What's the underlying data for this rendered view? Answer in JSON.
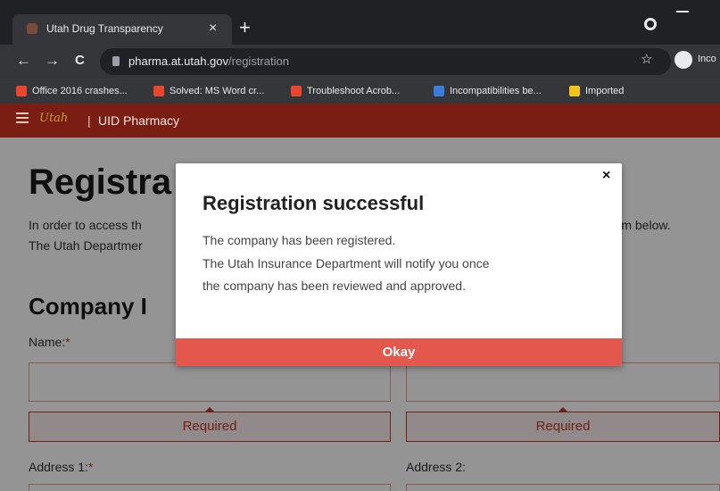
{
  "browser": {
    "tab_title": "Utah Drug Transparency",
    "tab_close": "×",
    "new_tab": "+",
    "back": "←",
    "forward": "→",
    "reload": "C",
    "url_host": "pharma.at.utah.gov",
    "url_path": "/registration",
    "star": "☆",
    "profile_label": "Inco"
  },
  "bookmarks": [
    {
      "label": "Office 2016 crashes...",
      "color": "#e8462f"
    },
    {
      "label": "Solved: MS Word cr...",
      "color": "#e8462f"
    },
    {
      "label": "Troubleshoot Acrob...",
      "color": "#e8462f"
    },
    {
      "label": "Incompatibilities be...",
      "color": "#3b7ddd"
    },
    {
      "label": "Imported",
      "color": "#f0c419"
    }
  ],
  "site": {
    "logo_text": "Utah",
    "separator": "|",
    "title": "UID Pharmacy"
  },
  "page": {
    "heading": "Registra",
    "intro_line1": "In order to access th",
    "intro_line1_end": "form below.",
    "intro_line2": "The Utah Departmer",
    "section_heading": "Company I",
    "name_label": "Name:",
    "required_mark": "*",
    "required_text": "Required",
    "address1_label": "Address 1:",
    "address2_label": "Address 2:"
  },
  "modal": {
    "close": "×",
    "title": "Registration successful",
    "line1": "The company has been registered.",
    "line2": "The Utah Insurance Department will notify you once",
    "line3": "the company has been reviewed and approved.",
    "ok_label": "Okay"
  },
  "colors": {
    "site_header": "#7a1e14",
    "required_red": "#c0392b",
    "okay_button": "#e4574c"
  }
}
